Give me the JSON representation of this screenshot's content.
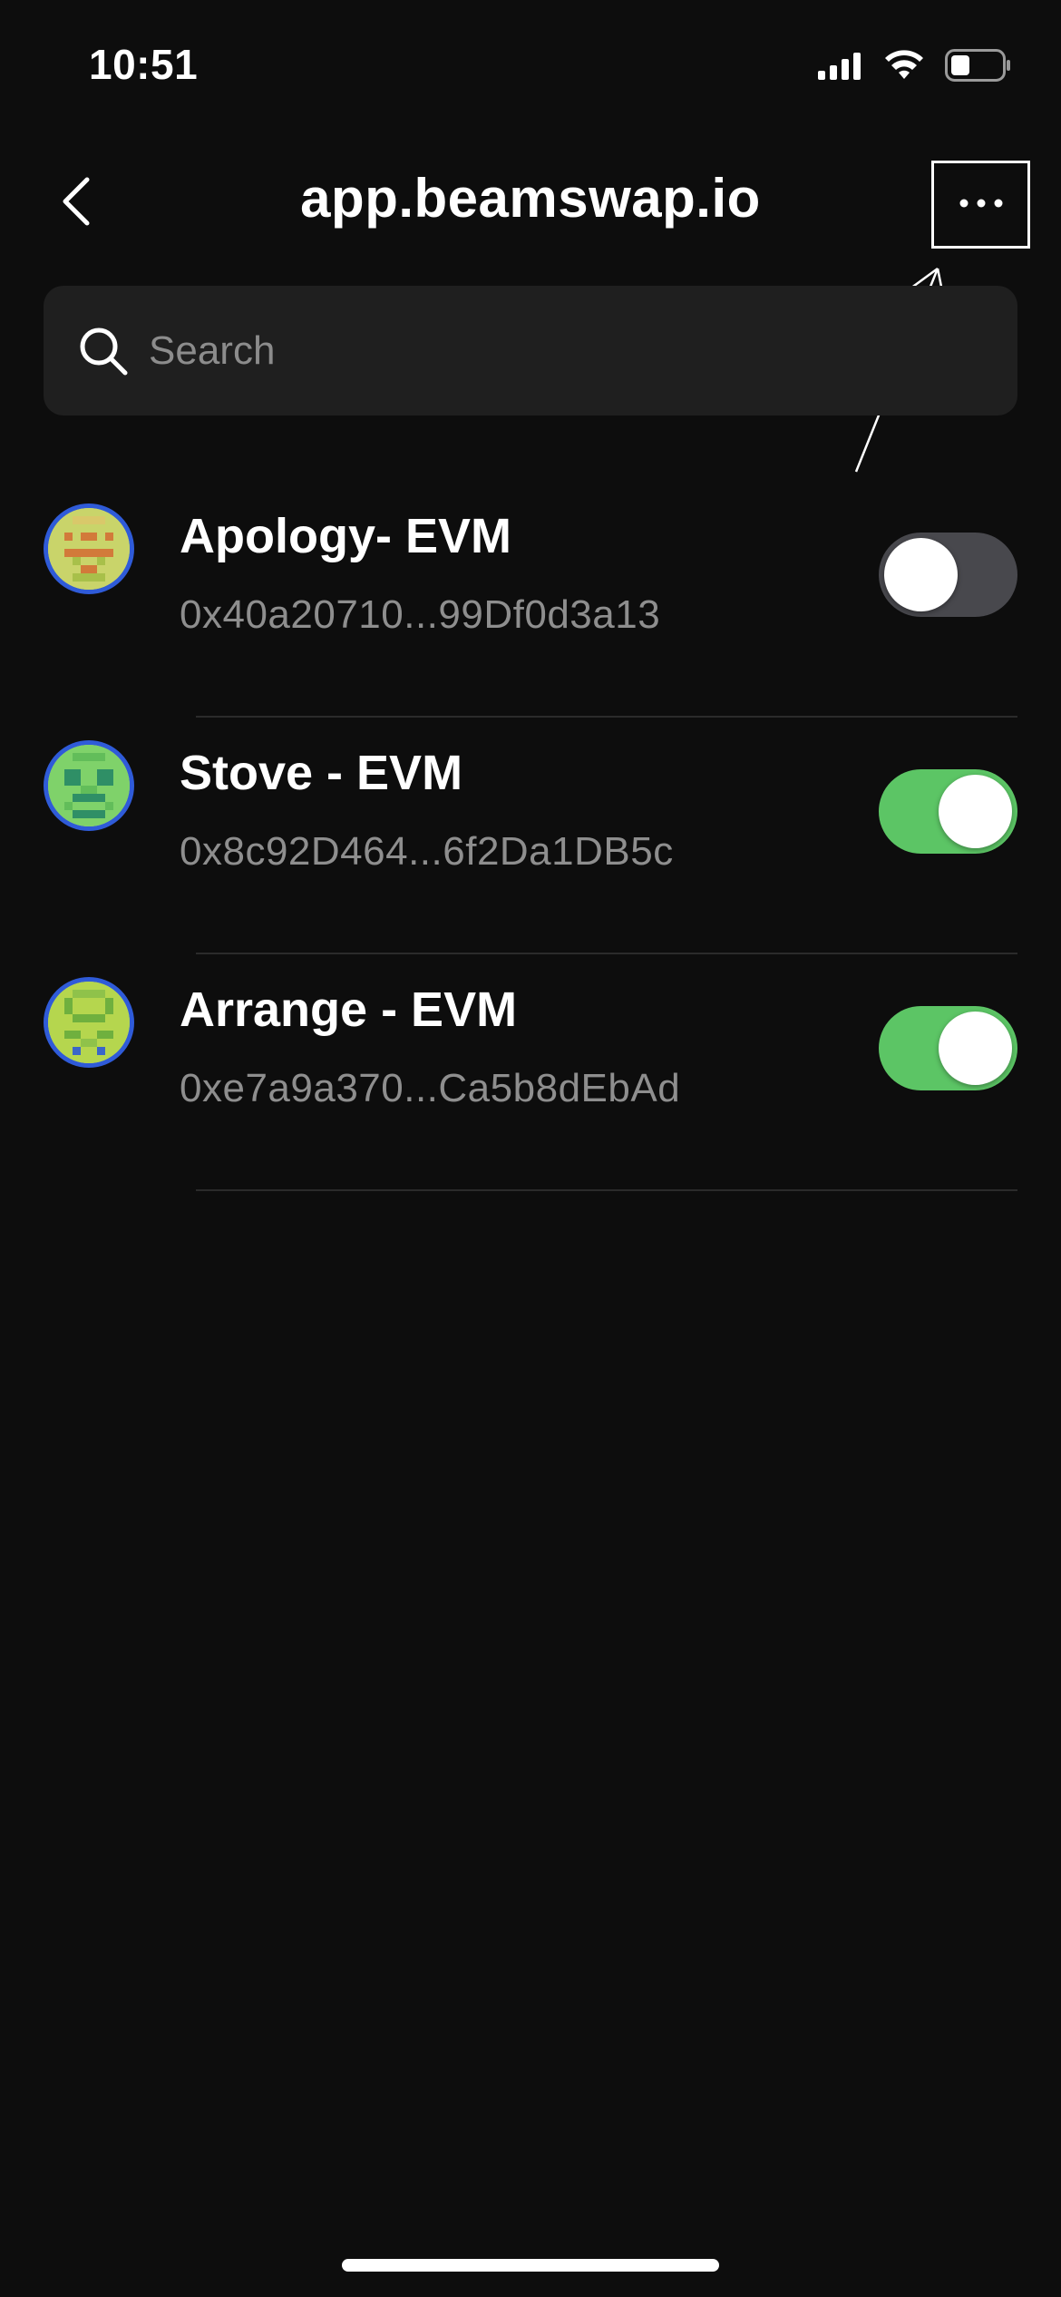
{
  "status_bar": {
    "time": "10:51",
    "icons": [
      "cellular-signal-icon",
      "wifi-icon",
      "battery-icon"
    ]
  },
  "header": {
    "title": "app.beamswap.io",
    "back_icon": "chevron-left-icon",
    "more_icon": "ellipsis-icon"
  },
  "search": {
    "placeholder": "Search",
    "value": ""
  },
  "accounts": [
    {
      "name": "Apology- EVM",
      "address": "0x40a20710...99Df0d3a13",
      "enabled": false
    },
    {
      "name": "Stove - EVM",
      "address": "0x8c92D464...6f2Da1DB5c",
      "enabled": true
    },
    {
      "name": "Arrange - EVM",
      "address": "0xe7a9a370...Ca5b8dEbAd",
      "enabled": true
    }
  ],
  "colors": {
    "background": "#0d0d0d",
    "search_bg": "#1f1f1f",
    "toggle_on": "#5cc565",
    "toggle_off": "#48484d",
    "avatar_ring": "#2f5bd8",
    "secondary_text": "#8e8e8e"
  }
}
